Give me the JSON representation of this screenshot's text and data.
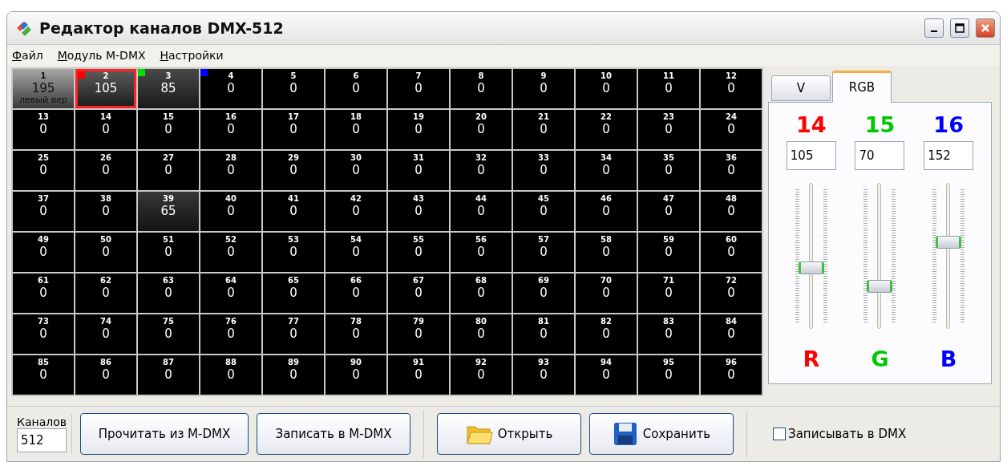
{
  "window": {
    "title": "Редактор каналов DMX-512"
  },
  "menu": [
    {
      "label": "Файл"
    },
    {
      "label": "Модуль M-DMX"
    },
    {
      "label": "Настройки"
    }
  ],
  "channels": [
    {
      "number": "1",
      "value": "195",
      "caption": "левый вер",
      "selected": false
    },
    {
      "number": "2",
      "value": "105",
      "selected": true,
      "color": "#ff0000"
    },
    {
      "number": "3",
      "value": "85",
      "selected": false,
      "color": "#00e000"
    },
    {
      "number": "4",
      "value": "0",
      "selected": false,
      "color": "#0000ff"
    },
    {
      "number": "5",
      "value": "0",
      "selected": false
    },
    {
      "number": "6",
      "value": "0",
      "selected": false
    },
    {
      "number": "7",
      "value": "0",
      "selected": false
    },
    {
      "number": "8",
      "value": "0",
      "selected": false
    },
    {
      "number": "9",
      "value": "0",
      "selected": false
    },
    {
      "number": "10",
      "value": "0",
      "selected": false
    },
    {
      "number": "11",
      "value": "0",
      "selected": false
    },
    {
      "number": "12",
      "value": "0",
      "selected": false
    },
    {
      "number": "13",
      "value": "0",
      "selected": false
    },
    {
      "number": "14",
      "value": "0",
      "selected": false
    },
    {
      "number": "15",
      "value": "0",
      "selected": false
    },
    {
      "number": "16",
      "value": "0",
      "selected": false
    },
    {
      "number": "17",
      "value": "0",
      "selected": false
    },
    {
      "number": "18",
      "value": "0",
      "selected": false
    },
    {
      "number": "19",
      "value": "0",
      "selected": false
    },
    {
      "number": "20",
      "value": "0",
      "selected": false
    },
    {
      "number": "21",
      "value": "0",
      "selected": false
    },
    {
      "number": "22",
      "value": "0",
      "selected": false
    },
    {
      "number": "23",
      "value": "0",
      "selected": false
    },
    {
      "number": "24",
      "value": "0",
      "selected": false
    },
    {
      "number": "25",
      "value": "0",
      "selected": false
    },
    {
      "number": "26",
      "value": "0",
      "selected": false
    },
    {
      "number": "27",
      "value": "0",
      "selected": false
    },
    {
      "number": "28",
      "value": "0",
      "selected": false
    },
    {
      "number": "29",
      "value": "0",
      "selected": false
    },
    {
      "number": "30",
      "value": "0",
      "selected": false
    },
    {
      "number": "31",
      "value": "0",
      "selected": false
    },
    {
      "number": "32",
      "value": "0",
      "selected": false
    },
    {
      "number": "33",
      "value": "0",
      "selected": false
    },
    {
      "number": "34",
      "value": "0",
      "selected": false
    },
    {
      "number": "35",
      "value": "0",
      "selected": false
    },
    {
      "number": "36",
      "value": "0",
      "selected": false
    },
    {
      "number": "37",
      "value": "0",
      "selected": false
    },
    {
      "number": "38",
      "value": "0",
      "selected": false
    },
    {
      "number": "39",
      "value": "65",
      "selected": false
    },
    {
      "number": "40",
      "value": "0",
      "selected": false
    },
    {
      "number": "41",
      "value": "0",
      "selected": false
    },
    {
      "number": "42",
      "value": "0",
      "selected": false
    },
    {
      "number": "43",
      "value": "0",
      "selected": false
    },
    {
      "number": "44",
      "value": "0",
      "selected": false
    },
    {
      "number": "45",
      "value": "0",
      "selected": false
    },
    {
      "number": "46",
      "value": "0",
      "selected": false
    },
    {
      "number": "47",
      "value": "0",
      "selected": false
    },
    {
      "number": "48",
      "value": "0",
      "selected": false
    },
    {
      "number": "49",
      "value": "0",
      "selected": false
    },
    {
      "number": "50",
      "value": "0",
      "selected": false
    },
    {
      "number": "51",
      "value": "0",
      "selected": false
    },
    {
      "number": "52",
      "value": "0",
      "selected": false
    },
    {
      "number": "53",
      "value": "0",
      "selected": false
    },
    {
      "number": "54",
      "value": "0",
      "selected": false
    },
    {
      "number": "55",
      "value": "0",
      "selected": false
    },
    {
      "number": "56",
      "value": "0",
      "selected": false
    },
    {
      "number": "57",
      "value": "0",
      "selected": false
    },
    {
      "number": "58",
      "value": "0",
      "selected": false
    },
    {
      "number": "59",
      "value": "0",
      "selected": false
    },
    {
      "number": "60",
      "value": "0",
      "selected": false
    },
    {
      "number": "61",
      "value": "0",
      "selected": false
    },
    {
      "number": "62",
      "value": "0",
      "selected": false
    },
    {
      "number": "63",
      "value": "0",
      "selected": false
    },
    {
      "number": "64",
      "value": "0",
      "selected": false
    },
    {
      "number": "65",
      "value": "0",
      "selected": false
    },
    {
      "number": "66",
      "value": "0",
      "selected": false
    },
    {
      "number": "67",
      "value": "0",
      "selected": false
    },
    {
      "number": "68",
      "value": "0",
      "selected": false
    },
    {
      "number": "69",
      "value": "0",
      "selected": false
    },
    {
      "number": "70",
      "value": "0",
      "selected": false
    },
    {
      "number": "71",
      "value": "0",
      "selected": false
    },
    {
      "number": "72",
      "value": "0",
      "selected": false
    },
    {
      "number": "73",
      "value": "0",
      "selected": false
    },
    {
      "number": "74",
      "value": "0",
      "selected": false
    },
    {
      "number": "75",
      "value": "0",
      "selected": false
    },
    {
      "number": "76",
      "value": "0",
      "selected": false
    },
    {
      "number": "77",
      "value": "0",
      "selected": false
    },
    {
      "number": "78",
      "value": "0",
      "selected": false
    },
    {
      "number": "79",
      "value": "0",
      "selected": false
    },
    {
      "number": "80",
      "value": "0",
      "selected": false
    },
    {
      "number": "81",
      "value": "0",
      "selected": false
    },
    {
      "number": "82",
      "value": "0",
      "selected": false
    },
    {
      "number": "83",
      "value": "0",
      "selected": false
    },
    {
      "number": "84",
      "value": "0",
      "selected": false
    },
    {
      "number": "85",
      "value": "0",
      "selected": false
    },
    {
      "number": "86",
      "value": "0",
      "selected": false
    },
    {
      "number": "87",
      "value": "0",
      "selected": false
    },
    {
      "number": "88",
      "value": "0",
      "selected": false
    },
    {
      "number": "89",
      "value": "0",
      "selected": false
    },
    {
      "number": "90",
      "value": "0",
      "selected": false
    },
    {
      "number": "91",
      "value": "0",
      "selected": false
    },
    {
      "number": "92",
      "value": "0",
      "selected": false
    },
    {
      "number": "93",
      "value": "0",
      "selected": false
    },
    {
      "number": "94",
      "value": "0",
      "selected": false
    },
    {
      "number": "95",
      "value": "0",
      "selected": false
    },
    {
      "number": "96",
      "value": "0",
      "selected": false
    }
  ],
  "tabs": [
    {
      "label": "V",
      "selected": false
    },
    {
      "label": "RGB",
      "selected": true
    }
  ],
  "rgb": [
    {
      "channel": "14",
      "value": "105",
      "letter": "R",
      "color": "#ff0000",
      "level": 0.41
    },
    {
      "channel": "15",
      "value": "70",
      "letter": "G",
      "color": "#00c800",
      "level": 0.27
    },
    {
      "channel": "16",
      "value": "152",
      "letter": "B",
      "color": "#0000ff",
      "level": 0.6
    }
  ],
  "footer": {
    "channels_label": "Каналов",
    "channels_value": "512",
    "buttons": [
      {
        "label": "Прочитать из M-DMX",
        "kind": "plain"
      },
      {
        "label": "Записать в M-DMX",
        "kind": "plain"
      },
      {
        "label": "Открыть",
        "kind": "folder"
      },
      {
        "label": "Сохранить",
        "kind": "disk"
      }
    ],
    "write_dmx": {
      "label": "Записывать в DMX",
      "checked": false
    }
  }
}
